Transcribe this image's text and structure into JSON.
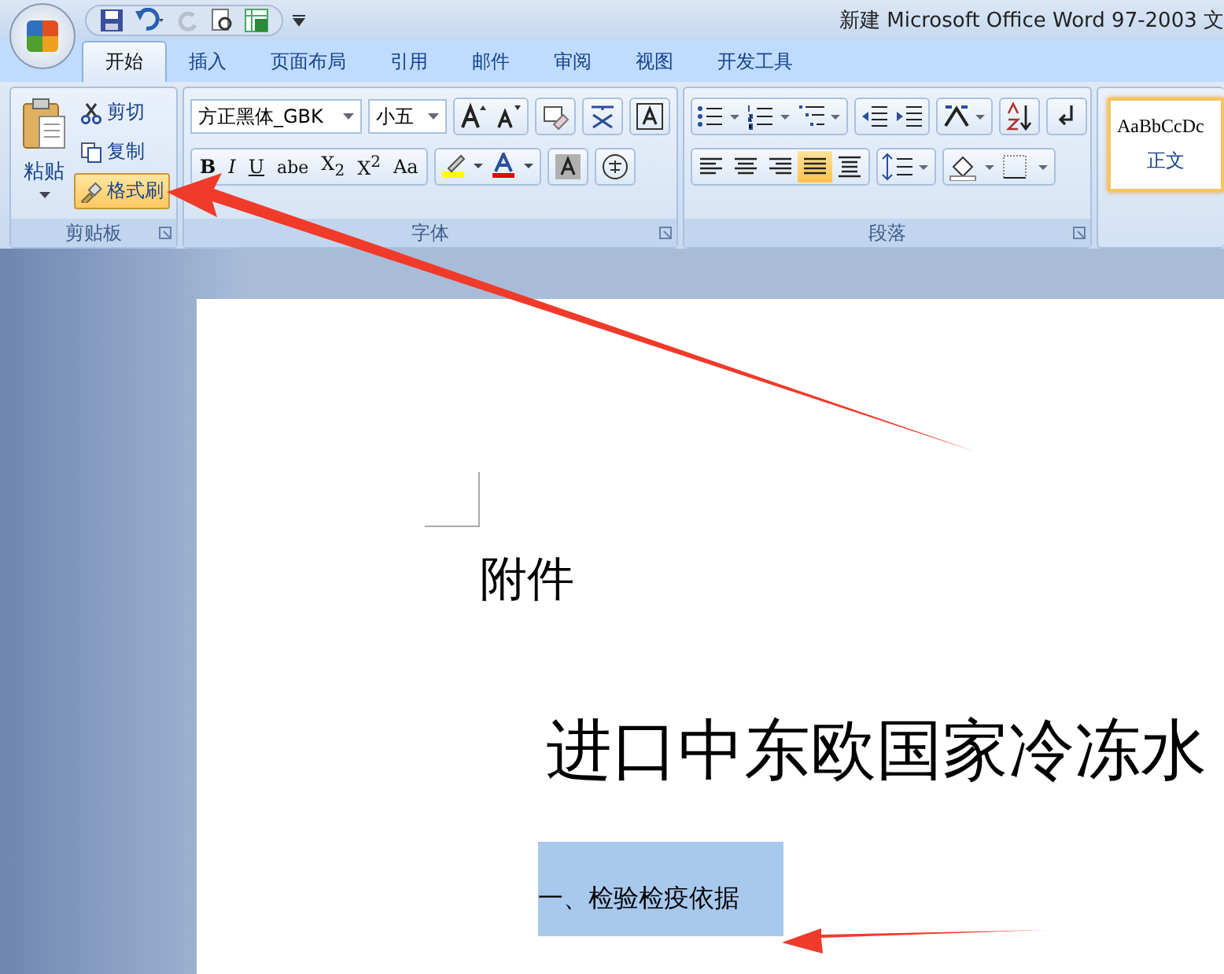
{
  "title_bar": {
    "title": "新建 Microsoft Office Word 97-2003 文"
  },
  "tabs": [
    {
      "label": "开始",
      "selected": true
    },
    {
      "label": "插入",
      "selected": false
    },
    {
      "label": "页面布局",
      "selected": false
    },
    {
      "label": "引用",
      "selected": false
    },
    {
      "label": "邮件",
      "selected": false
    },
    {
      "label": "审阅",
      "selected": false
    },
    {
      "label": "视图",
      "selected": false
    },
    {
      "label": "开发工具",
      "selected": false
    }
  ],
  "clipboard": {
    "paste": "粘贴",
    "cut": "剪切",
    "copy": "复制",
    "format_painter": {
      "label": "格式刷",
      "active": true
    },
    "group_label": "剪贴板"
  },
  "font": {
    "font_name": "方正黑体_GBK",
    "font_size": "小五",
    "format_buttons": [
      "B",
      "I",
      "U",
      "abe",
      "X$_{2}$",
      "X$^{2}$",
      "Aa"
    ],
    "group_label": "字体"
  },
  "paragraph": {
    "align_buttons": [
      {
        "selected": false
      },
      {
        "selected": false
      },
      {
        "selected": false
      },
      {
        "selected": true
      },
      {
        "selected": false
      }
    ],
    "group_label": "段落"
  },
  "styles": {
    "preview": "AaBbCcDc",
    "name": "正文",
    "selected": true
  },
  "document": {
    "attachment": "附件",
    "heading": "进口中东欧国家冷冻水",
    "section": {
      "text": "一、检验检疫依据",
      "selected": true
    }
  }
}
